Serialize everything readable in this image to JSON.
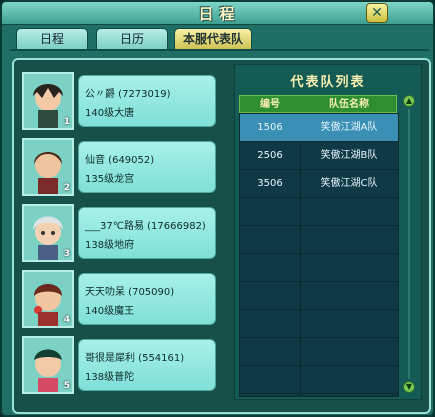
{
  "window": {
    "title": "日程"
  },
  "tabs": [
    {
      "label": "日程",
      "active": false
    },
    {
      "label": "日历",
      "active": false
    },
    {
      "label": "本服代表队",
      "active": true
    }
  ],
  "team_panel": {
    "title": "代表队列表",
    "columns": [
      "编号",
      "队伍名称"
    ],
    "rows": [
      {
        "id": "1506",
        "name": "笑傲江湖A队",
        "selected": true
      },
      {
        "id": "2506",
        "name": "笑傲江湖B队",
        "selected": false
      },
      {
        "id": "3506",
        "name": "笑傲江湖C队",
        "selected": false
      }
    ]
  },
  "players": [
    {
      "name": "公〃爵 (7273019)",
      "level": "140级大唐",
      "rank": "1"
    },
    {
      "name": "仙音 (649052)",
      "level": "135级龙宫",
      "rank": "2"
    },
    {
      "name": "___37℃路易 (17666982)",
      "level": "138级地府",
      "rank": "3"
    },
    {
      "name": "天天叻呆 (705090)",
      "level": "140级魔王",
      "rank": "4"
    },
    {
      "name": "哥很是犀利 (554161)",
      "level": "138级普陀",
      "rank": "5"
    }
  ],
  "colors": {
    "frame": "#1f6f66",
    "accent": "#f6f0a4",
    "header_green": "#2d8f2f",
    "selected_row": "#3a8fb4"
  }
}
